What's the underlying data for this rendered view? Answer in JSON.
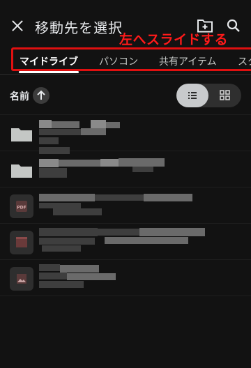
{
  "header": {
    "title": "移動先を選択",
    "annotation": "左へスライドする"
  },
  "tabs": [
    {
      "label": "マイドライブ",
      "active": true
    },
    {
      "label": "パソコン",
      "active": false
    },
    {
      "label": "共有アイテム",
      "active": false
    },
    {
      "label": "スタ",
      "active": false
    }
  ],
  "sort": {
    "label": "名前",
    "direction": "ascending"
  },
  "view_mode": "list",
  "items": [
    {
      "type": "folder"
    },
    {
      "type": "folder"
    },
    {
      "type": "pdf",
      "badge": "PDF"
    },
    {
      "type": "video"
    },
    {
      "type": "image"
    }
  ],
  "colors": {
    "annotation": "#ff1a1a",
    "background": "#121212",
    "active_tab": "#ffffff"
  }
}
